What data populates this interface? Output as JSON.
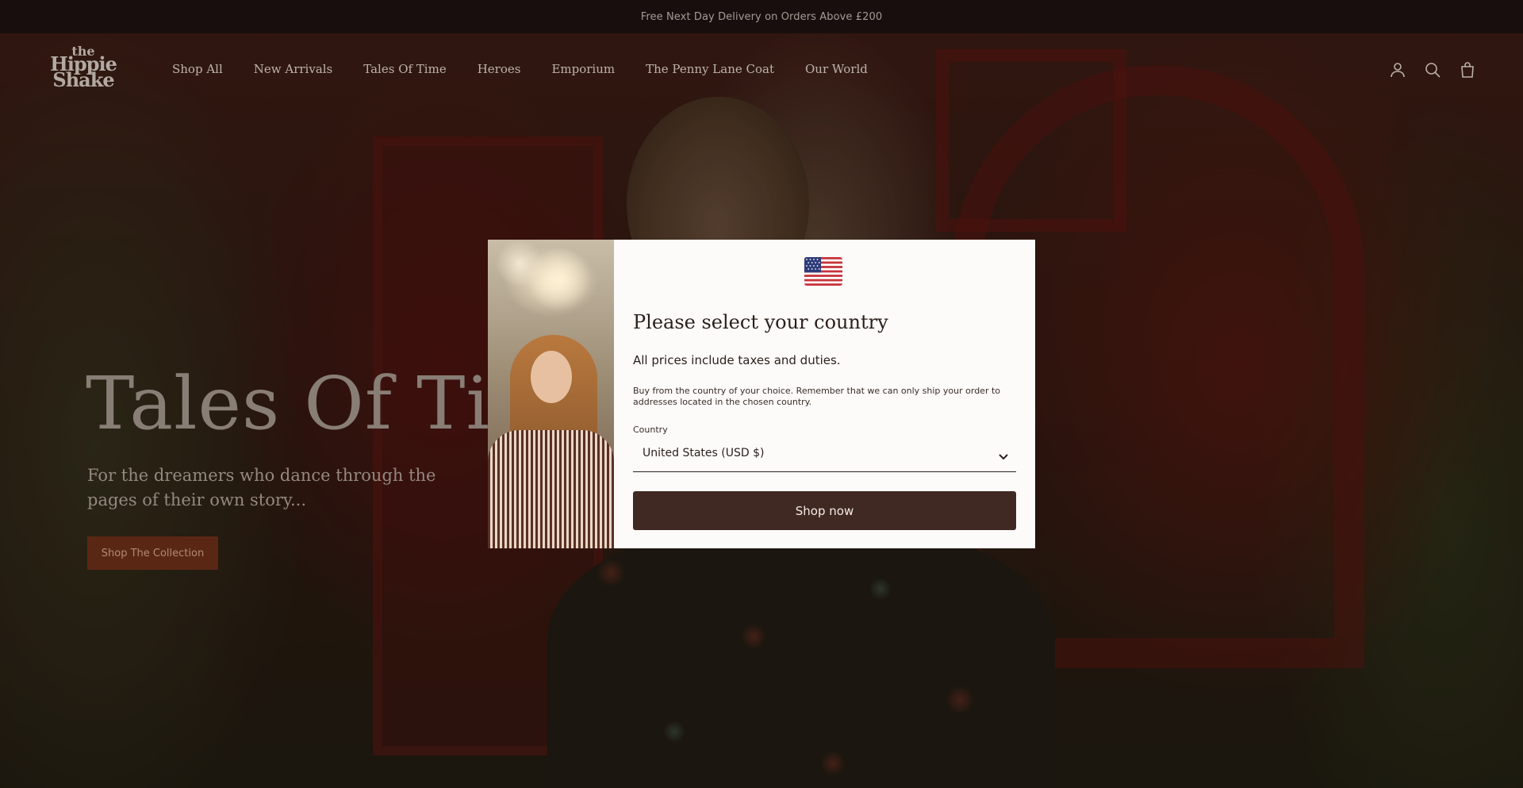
{
  "announcement": {
    "text": "Free Next Day Delivery on Orders Above £200"
  },
  "logo": {
    "line1": "the",
    "line2": "Hippie",
    "line3": "Shake"
  },
  "nav": {
    "items": [
      {
        "label": "Shop All"
      },
      {
        "label": "New Arrivals"
      },
      {
        "label": "Tales Of Time"
      },
      {
        "label": "Heroes"
      },
      {
        "label": "Emporium"
      },
      {
        "label": "The Penny Lane Coat"
      },
      {
        "label": "Our World"
      }
    ]
  },
  "header_icons": [
    "account-icon",
    "search-icon",
    "bag-icon"
  ],
  "hero": {
    "title": "Tales Of Time",
    "subtitle": "For the dreamers who dance through the pages of their own story...",
    "cta": "Shop The Collection"
  },
  "modal": {
    "flag_icon": "us-flag-icon",
    "title": "Please select your country",
    "p1": "All prices include taxes and duties.",
    "p2": "Buy from the country of your choice. Remember that we can only ship your order to addresses located in the chosen country.",
    "country_label": "Country",
    "country_value": "United States (USD $)",
    "button": "Shop now"
  },
  "colors": {
    "announcement_bg": "#1f1212",
    "cta_bg": "#6e3019",
    "modal_button_bg": "#402823",
    "modal_bg": "#fcfbfa"
  }
}
